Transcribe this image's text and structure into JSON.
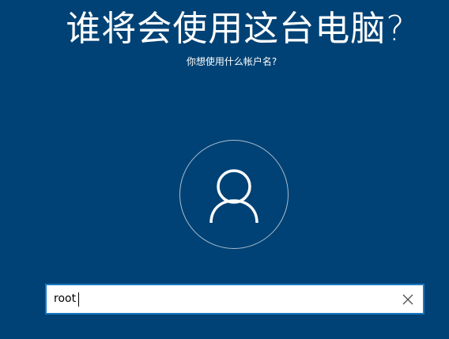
{
  "setup": {
    "title": "谁将会使用这台电脑?",
    "subtitle": "你想使用什么帐户名?"
  },
  "account": {
    "username_value": "root",
    "avatar_icon": "user-icon",
    "clear_icon": "close-icon"
  },
  "colors": {
    "background": "#004275",
    "field_border": "#1a78c2",
    "avatar_ring": "#a9bdd0"
  }
}
